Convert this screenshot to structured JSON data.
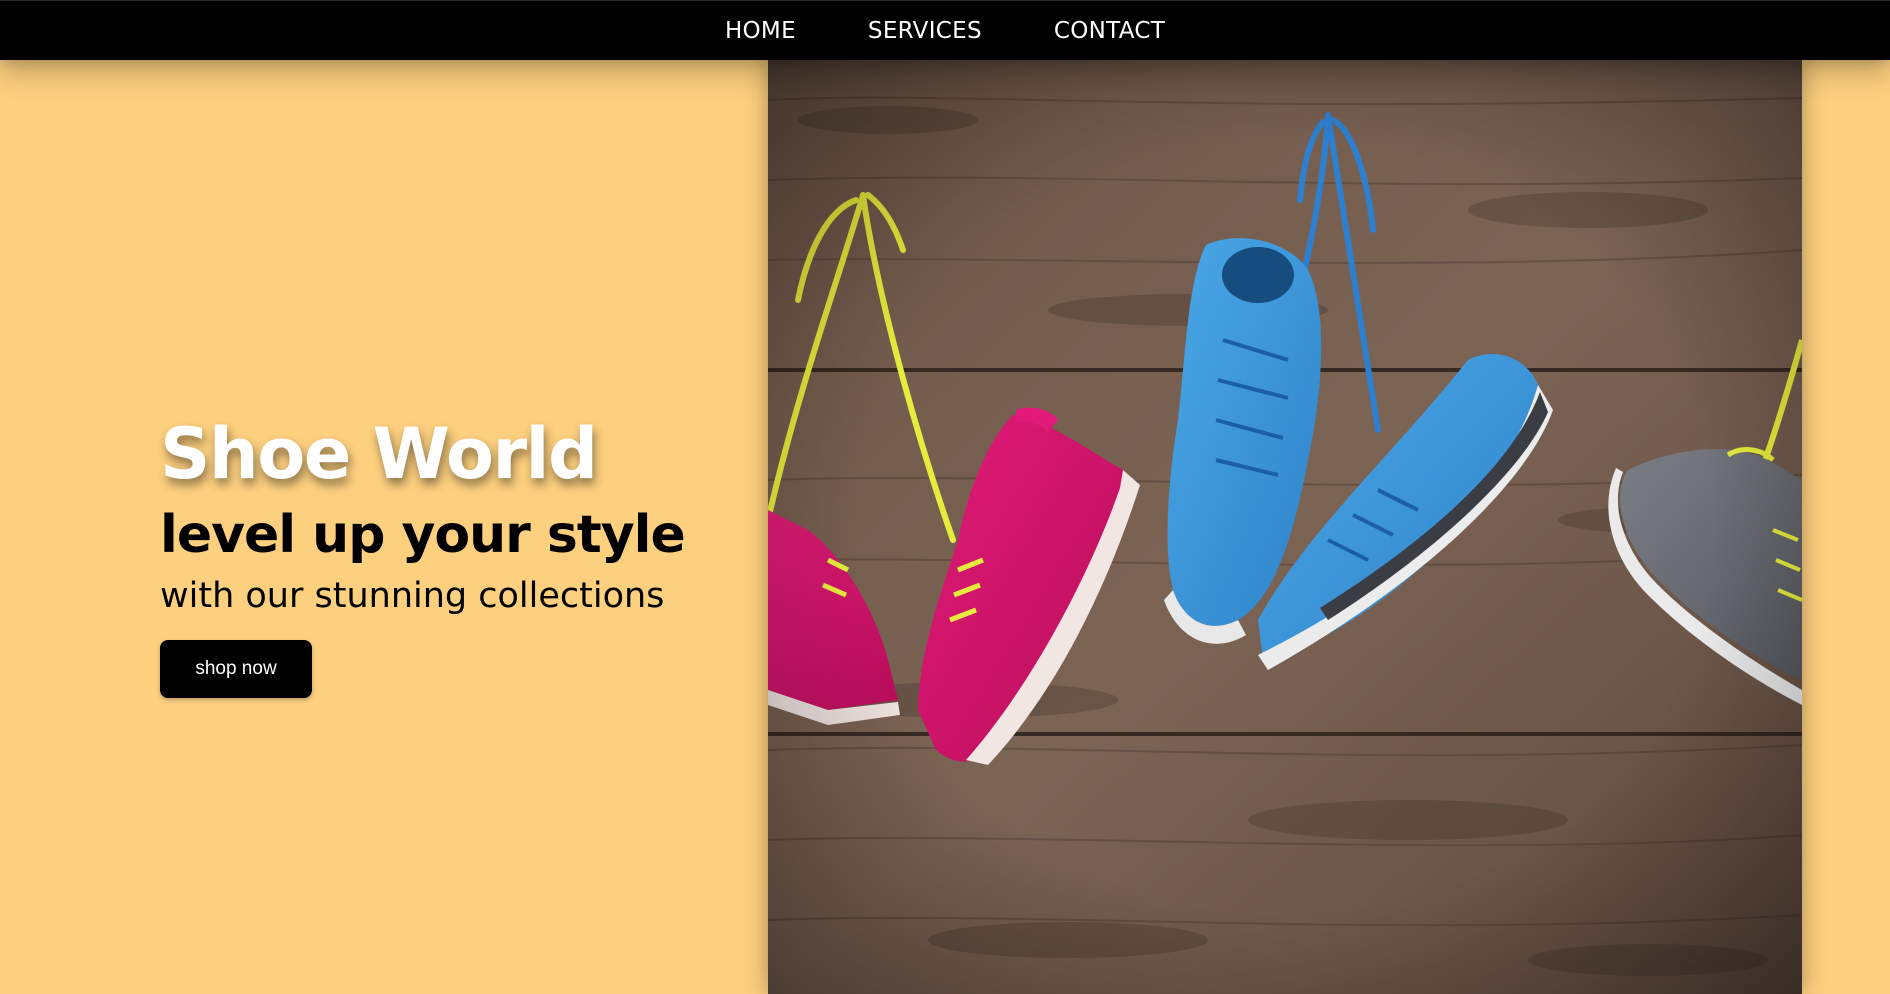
{
  "nav": {
    "links": [
      {
        "label": "HOME"
      },
      {
        "label": "SERVICES"
      },
      {
        "label": "CONTACT"
      }
    ]
  },
  "hero": {
    "title": "Shoe World",
    "tagline": "level up your style",
    "subline": "with our stunning collections",
    "button_label": "shop now"
  },
  "colors": {
    "page_background": "#fdd07f",
    "navbar": "#000000",
    "button": "#000000",
    "title_text": "#ffffff"
  },
  "image": {
    "subject": "shoes-hanging-on-wooden-wall-icon"
  }
}
